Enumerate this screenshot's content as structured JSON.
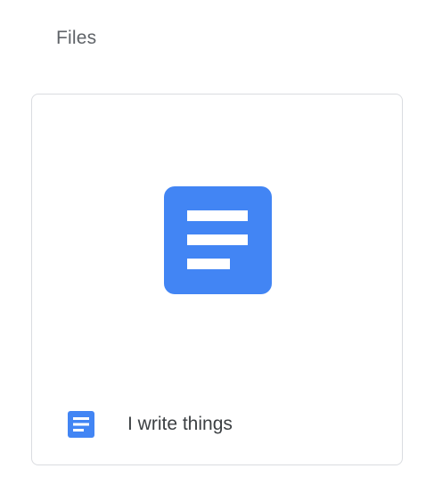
{
  "section": {
    "title": "Files"
  },
  "files": [
    {
      "name": "I write things",
      "type_icon": "google-docs-icon",
      "preview_icon": "document-lines-icon",
      "accent_color": "#4285f4"
    }
  ],
  "colors": {
    "title_text": "#5f6368",
    "file_name_text": "#3c4043",
    "card_border": "#dadce0",
    "doc_blue": "#4285f4"
  }
}
